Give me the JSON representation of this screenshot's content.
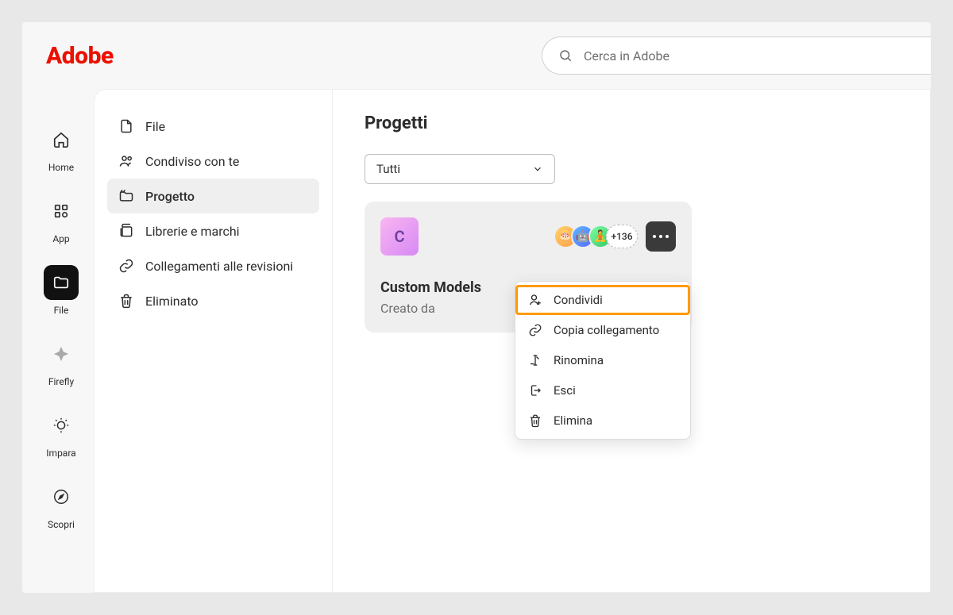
{
  "brand": "Adobe",
  "search": {
    "placeholder": "Cerca in Adobe"
  },
  "rail": {
    "home": "Home",
    "app": "App",
    "file": "File",
    "firefly": "Firefly",
    "learn": "Impara",
    "discover": "Scopri"
  },
  "sidebar": {
    "file": "File",
    "shared": "Condiviso con te",
    "project": "Progetto",
    "libraries": "Librerie e marchi",
    "reviews": "Collegamenti alle revisioni",
    "deleted": "Eliminato"
  },
  "main": {
    "title": "Progetti",
    "filter": "Tutti"
  },
  "card": {
    "letter": "C",
    "member_overflow": "+136",
    "title": "Custom Models",
    "subtitle": "Creato da"
  },
  "menu": {
    "share": "Condividi",
    "copylink": "Copia collegamento",
    "rename": "Rinomina",
    "leave": "Esci",
    "delete": "Elimina"
  }
}
